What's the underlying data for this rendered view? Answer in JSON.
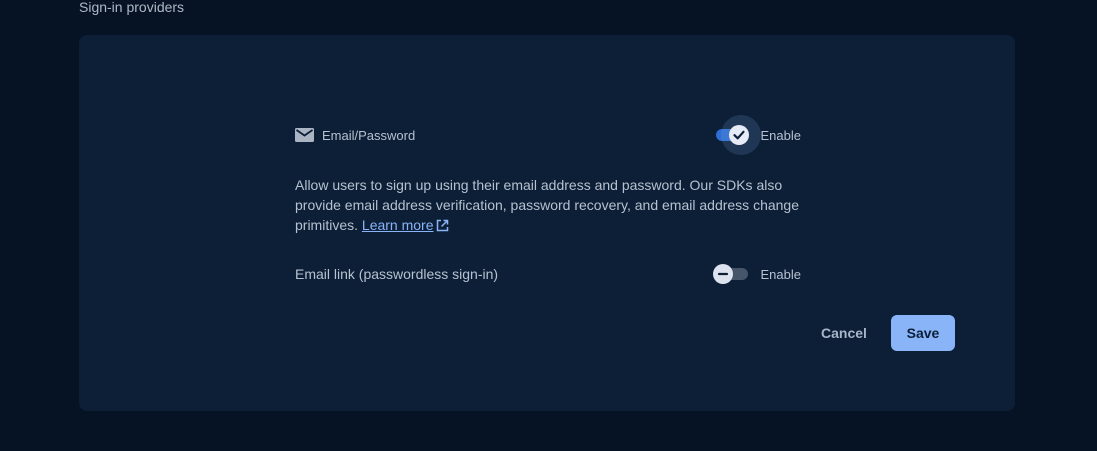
{
  "section": {
    "title": "Sign-in providers"
  },
  "providers": [
    {
      "icon": "mail-icon",
      "label": "Email/Password",
      "toggle_label": "Enable",
      "enabled": true,
      "description": "Allow users to sign up using their email address and password. Our SDKs also provide email address verification, password recovery, and email address change primitives.",
      "link_text": "Learn more",
      "link_icon": "open-in-new-icon"
    },
    {
      "label": "Email link (passwordless sign-in)",
      "toggle_label": "Enable",
      "enabled": false
    }
  ],
  "actions": {
    "cancel_label": "Cancel",
    "save_label": "Save"
  },
  "colors": {
    "background": "#061324",
    "card": "#0c1f37",
    "accent": "#8ab4f8",
    "toggle_on": "#2f6fd4",
    "toggle_off": "#46556a"
  }
}
